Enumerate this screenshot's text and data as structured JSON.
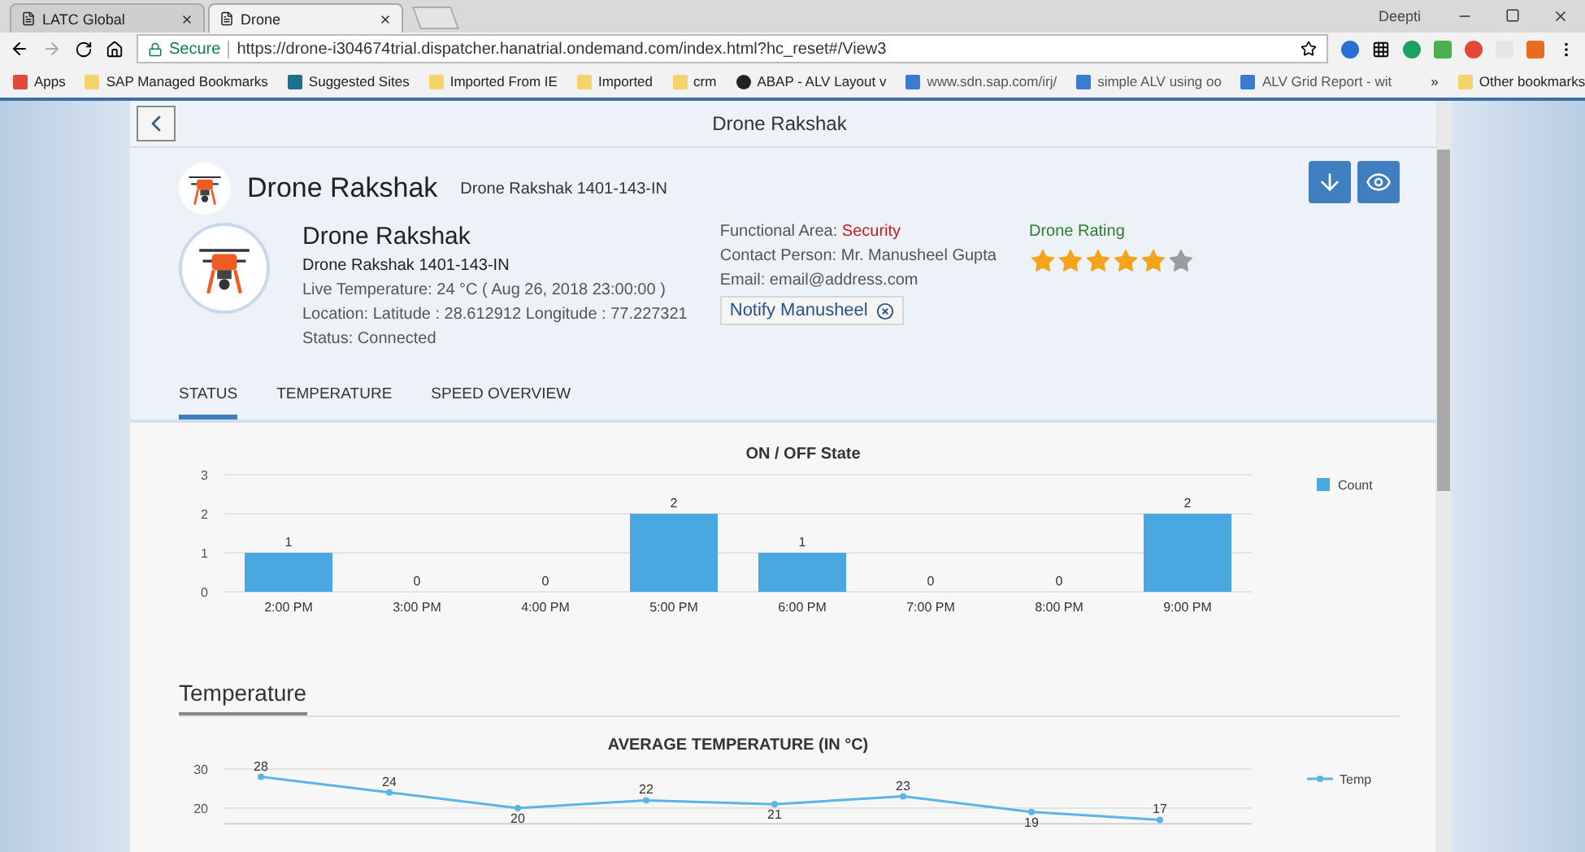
{
  "browser": {
    "tabs": [
      {
        "title": "LATC Global",
        "selected": false
      },
      {
        "title": "Drone",
        "selected": true
      }
    ],
    "user": "Deepti",
    "secure_label": "Secure",
    "url": "https://drone-i304674trial.dispatcher.hanatrial.ondemand.com/index.html?hc_reset#/View3",
    "bookmarks": [
      {
        "label": "Apps",
        "kind": "apps"
      },
      {
        "label": "SAP Managed Bookmarks",
        "kind": "folder"
      },
      {
        "label": "Suggested Sites",
        "kind": "bing"
      },
      {
        "label": "Imported From IE",
        "kind": "folder"
      },
      {
        "label": "Imported",
        "kind": "folder"
      },
      {
        "label": "crm",
        "kind": "folder"
      },
      {
        "label": "ABAP - ALV Layout v",
        "kind": "circle"
      },
      {
        "label": "www.sdn.sap.com/irj/",
        "kind": "sap"
      },
      {
        "label": "simple ALV using oo",
        "kind": "sap"
      },
      {
        "label": "ALV Grid Report - wit",
        "kind": "sap"
      }
    ],
    "overflow": "»",
    "other_bookmarks": "Other bookmarks"
  },
  "app": {
    "page_title": "Drone Rakshak",
    "header": {
      "title": "Drone Rakshak",
      "subtitle": "Drone Rakshak 1401-143-IN"
    },
    "details": {
      "name": "Drone Rakshak",
      "id": "Drone Rakshak 1401-143-IN",
      "lines": [
        "Live Temperature: 24 °C ( Aug 26, 2018 23:00:00 )",
        "Location: Latitude : 28.612912 Longitude : 77.227321",
        "Status: Connected"
      ]
    },
    "contact": {
      "area_label": "Functional Area:",
      "area_value": "Security",
      "person": "Contact Person: Mr. Manusheel Gupta",
      "email": "Email: email@address.com",
      "notify": "Notify Manusheel"
    },
    "rating": {
      "label": "Drone Rating",
      "stars": 5
    },
    "tabs": [
      {
        "label": "STATUS",
        "selected": true
      },
      {
        "label": "TEMPERATURE",
        "selected": false
      },
      {
        "label": "SPEED OVERVIEW",
        "selected": false
      }
    ],
    "status_chart": {
      "chart_data": {
        "type": "bar",
        "title": "ON / OFF State",
        "categories": [
          "2:00 PM",
          "3:00 PM",
          "4:00 PM",
          "5:00 PM",
          "6:00 PM",
          "7:00 PM",
          "8:00 PM",
          "9:00 PM"
        ],
        "series": [
          {
            "name": "Count",
            "color": "#4aa8e0",
            "values": [
              1,
              0,
              0,
              2,
              1,
              0,
              0,
              2
            ]
          }
        ],
        "ylim": [
          0,
          3
        ],
        "yticks": [
          0,
          1,
          2,
          3
        ],
        "data_labels": true
      }
    },
    "temperature_section": {
      "title": "Temperature",
      "chart_data": {
        "type": "line",
        "title": "AVERAGE TEMPERATURE (IN °C)",
        "series": [
          {
            "name": "Temp",
            "color": "#5ab4e6",
            "marker": "circle",
            "values": [
              28,
              24,
              20,
              22,
              21,
              23,
              19,
              17
            ]
          }
        ],
        "ylim": [
          16,
          30
        ],
        "yticks": [
          20,
          30
        ],
        "data_labels": true
      }
    }
  }
}
